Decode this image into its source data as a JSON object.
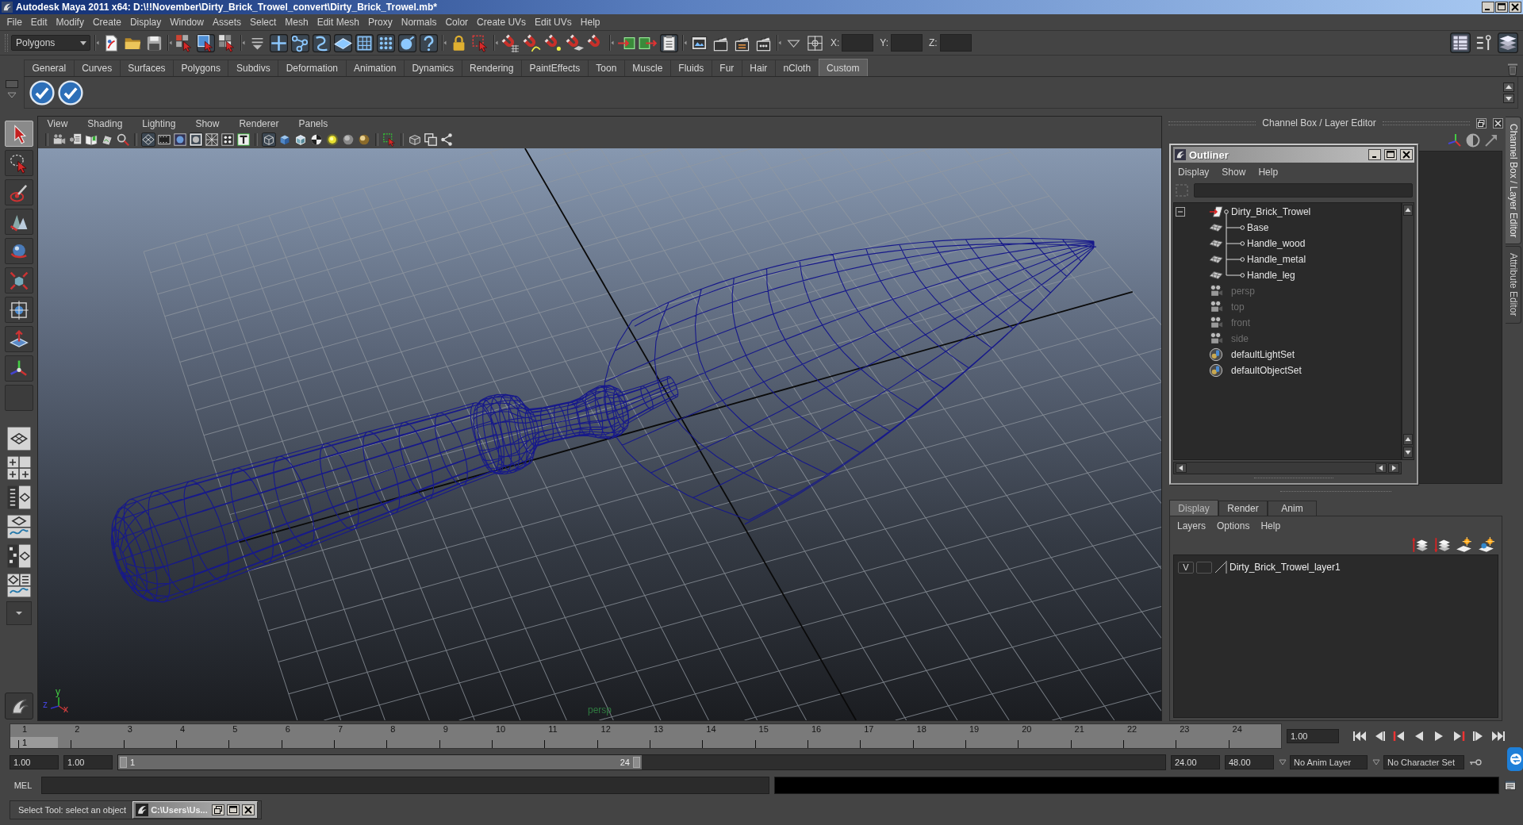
{
  "window": {
    "title": "Autodesk Maya 2011 x64: D:\\!!November\\Dirty_Brick_Trowel_convert\\Dirty_Brick_Trowel.mb*"
  },
  "menu_bar": [
    "File",
    "Edit",
    "Modify",
    "Create",
    "Display",
    "Window",
    "Assets",
    "Select",
    "Mesh",
    "Edit Mesh",
    "Proxy",
    "Normals",
    "Color",
    "Create UVs",
    "Edit UVs",
    "Help"
  ],
  "status_line": {
    "menu_set": "Polygons",
    "button_groups": [
      [
        {
          "on": false
        },
        {
          "on": false
        },
        {
          "on": false
        }
      ],
      [
        {
          "on": false
        },
        {
          "on": true
        },
        {
          "on": false
        }
      ],
      [
        {
          "on": false
        },
        {
          "on": true
        },
        {
          "on": true
        },
        {
          "on": true
        },
        {
          "on": true
        },
        {
          "on": true
        },
        {
          "on": true
        },
        {
          "on": true
        },
        {
          "on": true
        }
      ],
      [
        {
          "on": false
        },
        {
          "on": false
        }
      ],
      [
        {
          "on": false
        },
        {
          "on": false
        },
        {
          "on": false
        },
        {
          "on": false
        },
        {
          "on": false
        }
      ],
      [
        {
          "on": false
        },
        {
          "on": false
        },
        {
          "on": true
        }
      ],
      [
        {
          "on": false
        },
        {
          "on": false
        },
        {
          "on": false
        },
        {
          "on": false
        }
      ],
      [
        {
          "on": false
        },
        {
          "on": false
        }
      ]
    ],
    "coordinate_labels": [
      "X:",
      "Y:",
      "Z:"
    ],
    "panel_toggles": [
      {
        "on": true
      },
      {
        "on": false
      },
      {
        "on": true
      }
    ]
  },
  "shelf": {
    "tabs": [
      {
        "label": "General",
        "selected": false
      },
      {
        "label": "Curves",
        "selected": false
      },
      {
        "label": "Surfaces",
        "selected": false
      },
      {
        "label": "Polygons",
        "selected": false
      },
      {
        "label": "Subdivs",
        "selected": false
      },
      {
        "label": "Deformation",
        "selected": false
      },
      {
        "label": "Animation",
        "selected": false
      },
      {
        "label": "Dynamics",
        "selected": false
      },
      {
        "label": "Rendering",
        "selected": false
      },
      {
        "label": "PaintEffects",
        "selected": false
      },
      {
        "label": "Toon",
        "selected": false
      },
      {
        "label": "Muscle",
        "selected": false
      },
      {
        "label": "Fluids",
        "selected": false
      },
      {
        "label": "Fur",
        "selected": false
      },
      {
        "label": "Hair",
        "selected": false
      },
      {
        "label": "nCloth",
        "selected": false
      },
      {
        "label": "Custom",
        "selected": true
      }
    ]
  },
  "toolbox": {
    "tools": [
      {
        "selected": true
      },
      {
        "selected": false
      },
      {
        "selected": false
      },
      {
        "selected": false
      },
      {
        "selected": false
      },
      {
        "selected": false
      },
      {
        "selected": false
      },
      {
        "selected": false
      },
      {
        "selected": false
      },
      {
        "selected": false
      }
    ]
  },
  "viewport": {
    "menu": [
      "View",
      "Shading",
      "Lighting",
      "Show",
      "Renderer",
      "Panels"
    ],
    "toolbar_groups": [
      [
        {
          "on": false
        },
        {
          "on": false
        },
        {
          "on": false
        },
        {
          "on": false
        },
        {
          "on": false
        }
      ],
      [
        {
          "on": true
        },
        {
          "on": false
        },
        {
          "on": false
        },
        {
          "on": true
        },
        {
          "on": false
        },
        {
          "on": false
        },
        {
          "on": false
        }
      ],
      [
        {
          "on": true
        },
        {
          "on": false
        },
        {
          "on": false
        },
        {
          "on": false
        },
        {
          "on": false
        },
        {
          "on": false
        },
        {
          "on": false
        }
      ],
      [
        {
          "on": false
        }
      ],
      [
        {
          "on": false
        },
        {
          "on": false
        },
        {
          "on": false
        }
      ]
    ],
    "camera_label": "persp",
    "axis_labels": [
      "y",
      "z",
      "x"
    ]
  },
  "channel_box": {
    "title": "Channel Box / Layer Editor"
  },
  "outliner": {
    "title": "Outliner",
    "menu": [
      "Display",
      "Show",
      "Help"
    ],
    "items": [
      {
        "label": "Dirty_Brick_Trowel",
        "kind": "transform",
        "hidden": false,
        "expanded": true,
        "children": [
          {
            "label": "Base",
            "kind": "mesh",
            "hidden": false
          },
          {
            "label": "Handle_wood",
            "kind": "mesh",
            "hidden": false
          },
          {
            "label": "Handle_metal",
            "kind": "mesh",
            "hidden": false
          },
          {
            "label": "Handle_leg",
            "kind": "mesh",
            "hidden": false
          }
        ]
      },
      {
        "label": "persp",
        "kind": "camera",
        "hidden": true
      },
      {
        "label": "top",
        "kind": "camera",
        "hidden": true
      },
      {
        "label": "front",
        "kind": "camera",
        "hidden": true
      },
      {
        "label": "side",
        "kind": "camera",
        "hidden": true
      },
      {
        "label": "defaultLightSet",
        "kind": "set",
        "hidden": false
      },
      {
        "label": "defaultObjectSet",
        "kind": "set",
        "hidden": false
      }
    ]
  },
  "layer_editor": {
    "tabs": [
      {
        "label": "Display",
        "selected": true
      },
      {
        "label": "Render",
        "selected": false
      },
      {
        "label": "Anim",
        "selected": false
      }
    ],
    "menu": [
      "Layers",
      "Options",
      "Help"
    ],
    "layers": [
      {
        "visibility": "V",
        "name": "Dirty_Brick_Trowel_layer1"
      }
    ]
  },
  "side_tabs": [
    {
      "label": "Channel Box / Layer Editor",
      "selected": true
    },
    {
      "label": "Attribute Editor",
      "selected": false
    }
  ],
  "time_slider": {
    "frames": [
      {
        "label": "1",
        "selected": true
      },
      {
        "label": "2",
        "selected": false
      },
      {
        "label": "3",
        "selected": false
      },
      {
        "label": "4",
        "selected": false
      },
      {
        "label": "5",
        "selected": false
      },
      {
        "label": "6",
        "selected": false
      },
      {
        "label": "7",
        "selected": false
      },
      {
        "label": "8",
        "selected": false
      },
      {
        "label": "9",
        "selected": false
      },
      {
        "label": "10",
        "selected": false
      },
      {
        "label": "11",
        "selected": false
      },
      {
        "label": "12",
        "selected": false
      },
      {
        "label": "13",
        "selected": false
      },
      {
        "label": "14",
        "selected": false
      },
      {
        "label": "15",
        "selected": false
      },
      {
        "label": "16",
        "selected": false
      },
      {
        "label": "17",
        "selected": false
      },
      {
        "label": "18",
        "selected": false
      },
      {
        "label": "19",
        "selected": false
      },
      {
        "label": "20",
        "selected": false
      },
      {
        "label": "21",
        "selected": false
      },
      {
        "label": "22",
        "selected": false
      },
      {
        "label": "23",
        "selected": false
      },
      {
        "label": "24",
        "selected": false
      }
    ],
    "current_frame": "1",
    "current_time": "1.00"
  },
  "range_slider": {
    "start_time": "1.00",
    "playback_start": "1.00",
    "range_start": "1",
    "range_end": "24",
    "level": 0.5,
    "playback_end": "24.00",
    "end_time": "48.00",
    "anim_layer": "No Anim Layer",
    "character_set": "No Character Set"
  },
  "command_line": {
    "language": "MEL"
  },
  "help_line": {
    "text": "Select Tool: select an object",
    "minimized_window": "C:\\Users\\Us..."
  }
}
